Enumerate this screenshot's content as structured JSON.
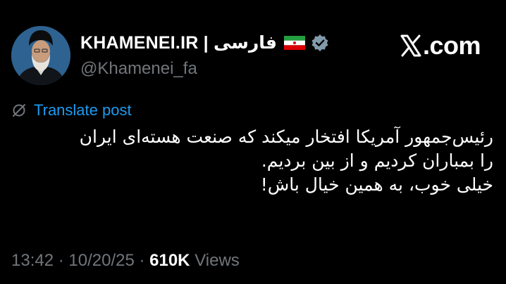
{
  "author": {
    "display_name": "KHAMENEI.IR | فارسی",
    "handle": "@Khamenei_fa",
    "avatar_icon": "portrait-avatar",
    "flag_icon": "iran-flag-icon",
    "verified_icon": "verified-badge-icon",
    "verified_color": "#829aab"
  },
  "brand": {
    "label": ".com",
    "mark_icon": "x-logo-icon"
  },
  "translate": {
    "label": "Translate post",
    "icon": "globe-slash-icon",
    "color": "#1d9bf0"
  },
  "tweet": {
    "lines": [
      "رئیس‌جمهور آمریکا افتخار میکند که صنعت هسته‌ای ایران",
      "را بمباران کردیم و از بین بردیم.",
      "خیلی خوب، به همین خیال باش!"
    ]
  },
  "meta": {
    "time": "13:42",
    "separator": " · ",
    "date": "10/20/25",
    "views_count": "610K",
    "views_label": "Views"
  }
}
